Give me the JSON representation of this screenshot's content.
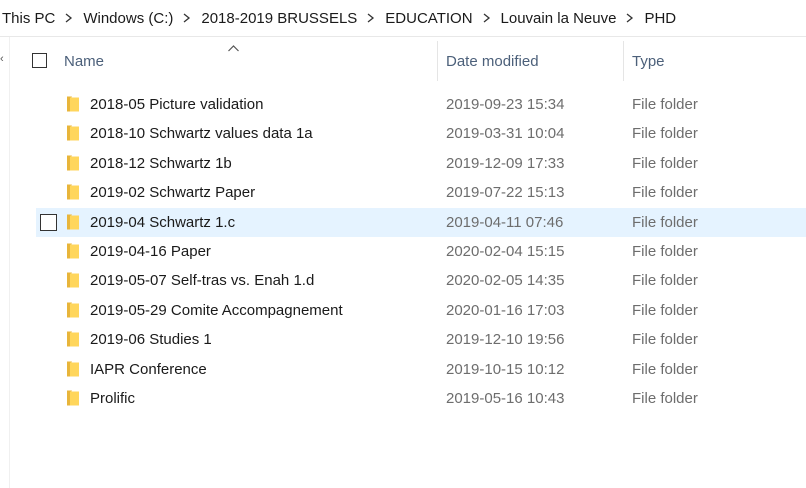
{
  "breadcrumb": {
    "items": [
      "This PC",
      "Windows (C:)",
      "2018-2019 BRUSSELS",
      "EDUCATION",
      "Louvain la Neuve",
      "PHD"
    ],
    "separator_icon": "chevron-right-icon"
  },
  "columns": {
    "name": "Name",
    "date": "Date modified",
    "type": "Type",
    "sort": "name-ascending"
  },
  "files": [
    {
      "name": "2018-05 Picture validation",
      "date": "2019-09-23 15:34",
      "type": "File folder"
    },
    {
      "name": "2018-10 Schwartz values data 1a",
      "date": "2019-03-31 10:04",
      "type": "File folder"
    },
    {
      "name": "2018-12 Schwartz 1b",
      "date": "2019-12-09 17:33",
      "type": "File folder"
    },
    {
      "name": "2019-02 Schwartz Paper",
      "date": "2019-07-22 15:13",
      "type": "File folder"
    },
    {
      "name": "2019-04 Schwartz 1.c",
      "date": "2019-04-11 07:46",
      "type": "File folder",
      "hover": true
    },
    {
      "name": "2019-04-16 Paper",
      "date": "2020-02-04 15:15",
      "type": "File folder"
    },
    {
      "name": "2019-05-07 Self-tras vs. Enah 1.d",
      "date": "2020-02-05 14:35",
      "type": "File folder"
    },
    {
      "name": "2019-05-29 Comite Accompagnement",
      "date": "2020-01-16 17:03",
      "type": "File folder"
    },
    {
      "name": "2019-06 Studies 1",
      "date": "2019-12-10 19:56",
      "type": "File folder"
    },
    {
      "name": "IAPR Conference",
      "date": "2019-10-15 10:12",
      "type": "File folder"
    },
    {
      "name": "Prolific",
      "date": "2019-05-16 10:43",
      "type": "File folder"
    }
  ],
  "icons": {
    "folder": "folder-icon",
    "sort": "sort-ascending-icon",
    "checkbox": "checkbox-icon"
  },
  "colors": {
    "folder_yellow": "#ffd65c",
    "folder_shade": "#e8b53a",
    "hover_row": "#e5f3ff",
    "header_text": "#4c607a",
    "secondary_text": "#6d6d6d"
  }
}
